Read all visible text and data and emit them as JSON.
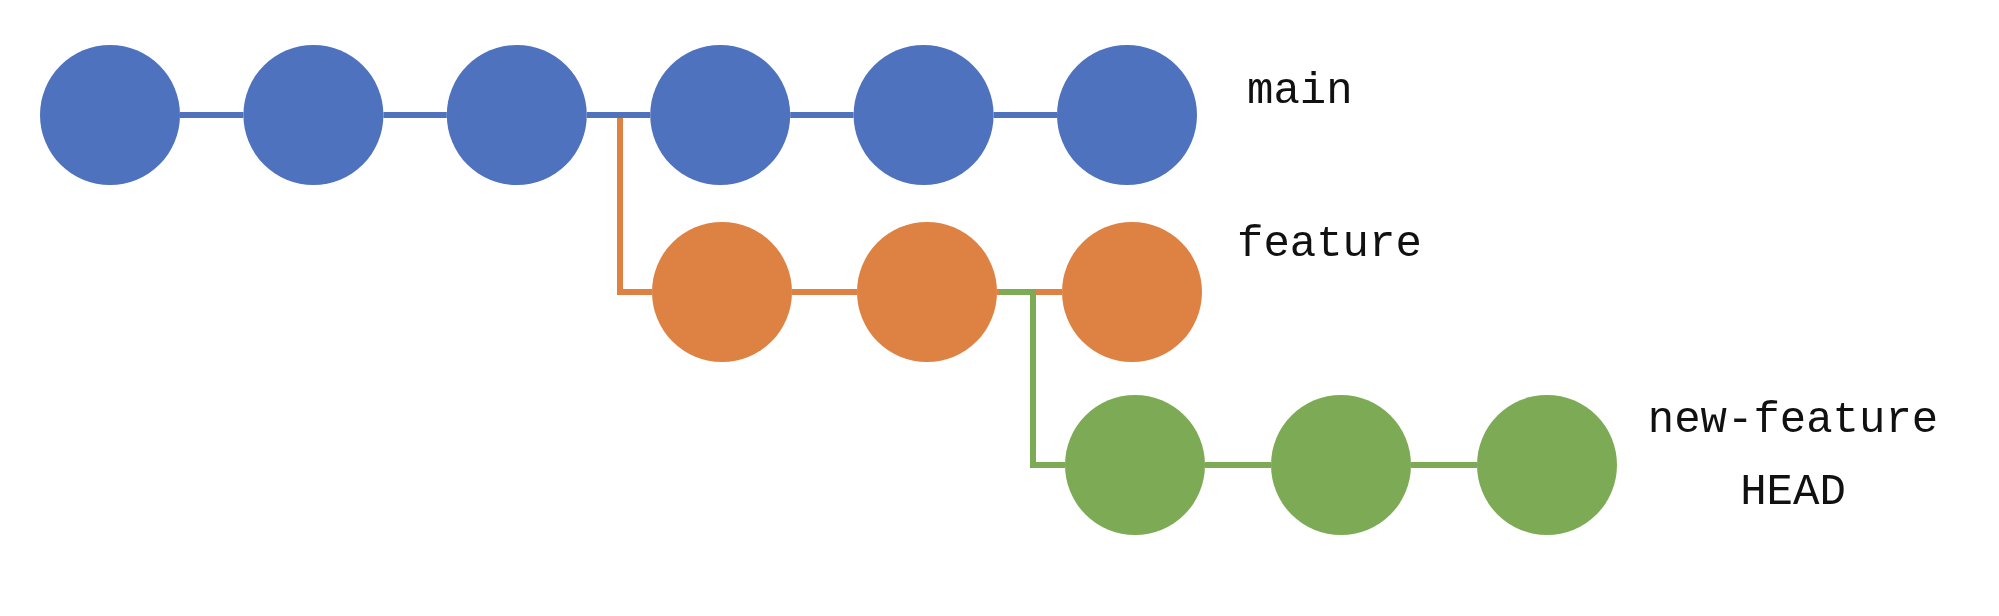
{
  "branches": [
    {
      "labels": [
        "main"
      ],
      "color": "#4e72be",
      "commits": [
        {
          "kind": "commit"
        },
        {
          "kind": "commit"
        },
        {
          "kind": "commit"
        },
        {
          "kind": "commit"
        },
        {
          "kind": "commit"
        },
        {
          "kind": "commit"
        }
      ]
    },
    {
      "labels": [
        "feature"
      ],
      "color": "#de8244",
      "commits": [
        {
          "kind": "commit"
        },
        {
          "kind": "commit"
        },
        {
          "kind": "commit"
        }
      ]
    },
    {
      "labels": [
        "new-feature",
        "HEAD"
      ],
      "color": "#7dab55",
      "commits": [
        {
          "kind": "commit"
        },
        {
          "kind": "commit"
        },
        {
          "kind": "commit"
        }
      ]
    }
  ]
}
